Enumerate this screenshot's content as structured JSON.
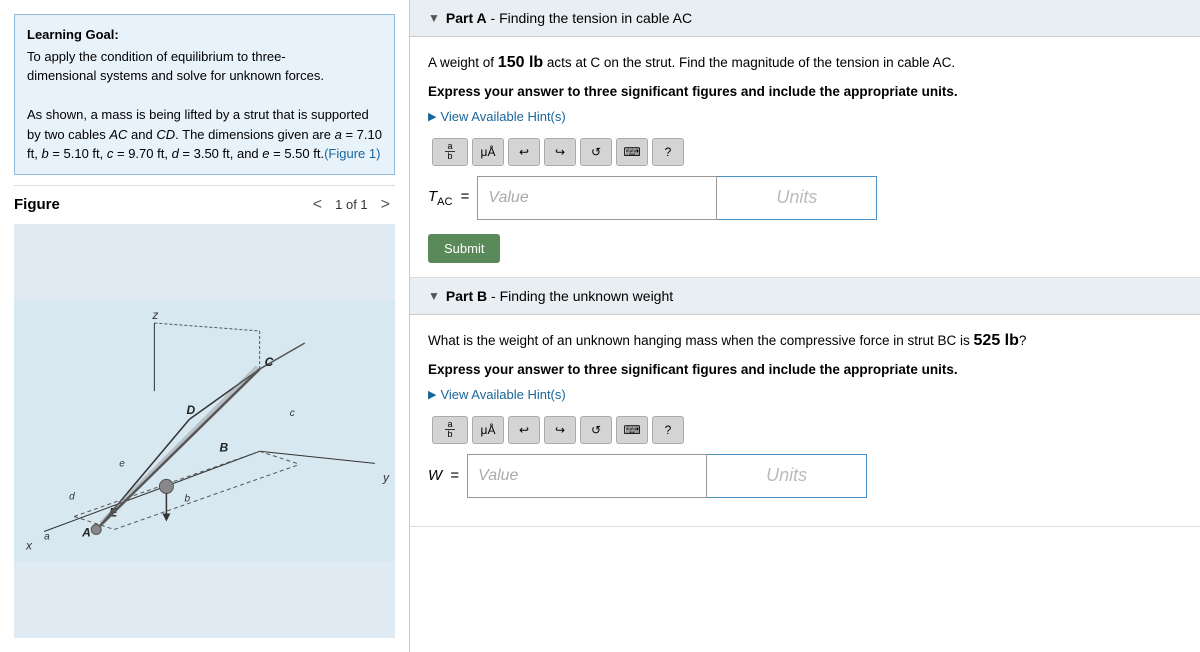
{
  "left": {
    "learning_goal": {
      "title": "Learning Goal:",
      "line1": "To apply the condition of equilibrium to three-",
      "line2": "dimensional systems and solve for unknown forces.",
      "paragraph": "As shown, a mass is being lifted by a strut that is supported by two cables AC and CD. The dimensions given are a = 7.10 ft, b = 5.10 ft, c = 9.70 ft, d = 3.50 ft, and e = 5.50 ft.",
      "figure_link": "(Figure 1)"
    },
    "figure": {
      "title": "Figure",
      "nav_label": "1 of 1",
      "prev_label": "<",
      "next_label": ">"
    }
  },
  "right": {
    "part_a": {
      "header_part": "Part A",
      "header_dash": " - ",
      "header_desc": "Finding the tension in cable AC",
      "problem_text_pre": "A weight of ",
      "problem_weight": "150 lb",
      "problem_text_post": " acts at C on the strut. Find the magnitude of the tension in cable AC.",
      "bold_instruction": "Express your answer to three significant figures and include the appropriate units.",
      "hint_text": "View Available Hint(s)",
      "answer_label": "T",
      "answer_subscript": "AC",
      "answer_equals": "=",
      "value_placeholder": "Value",
      "units_placeholder": "Units",
      "submit_label": "Submit"
    },
    "part_b": {
      "header_part": "Part B",
      "header_dash": " - ",
      "header_desc": "Finding the unknown weight",
      "problem_text_pre": "What is the weight of an unknown hanging mass when the compressive force in strut BC is ",
      "problem_compress": "525 lb",
      "problem_text_post": "?",
      "bold_instruction": "Express your answer to three significant figures and include the appropriate units.",
      "hint_text": "View Available Hint(s)",
      "answer_label": "W",
      "answer_equals": "=",
      "value_placeholder": "Value",
      "units_placeholder": "Units"
    }
  }
}
